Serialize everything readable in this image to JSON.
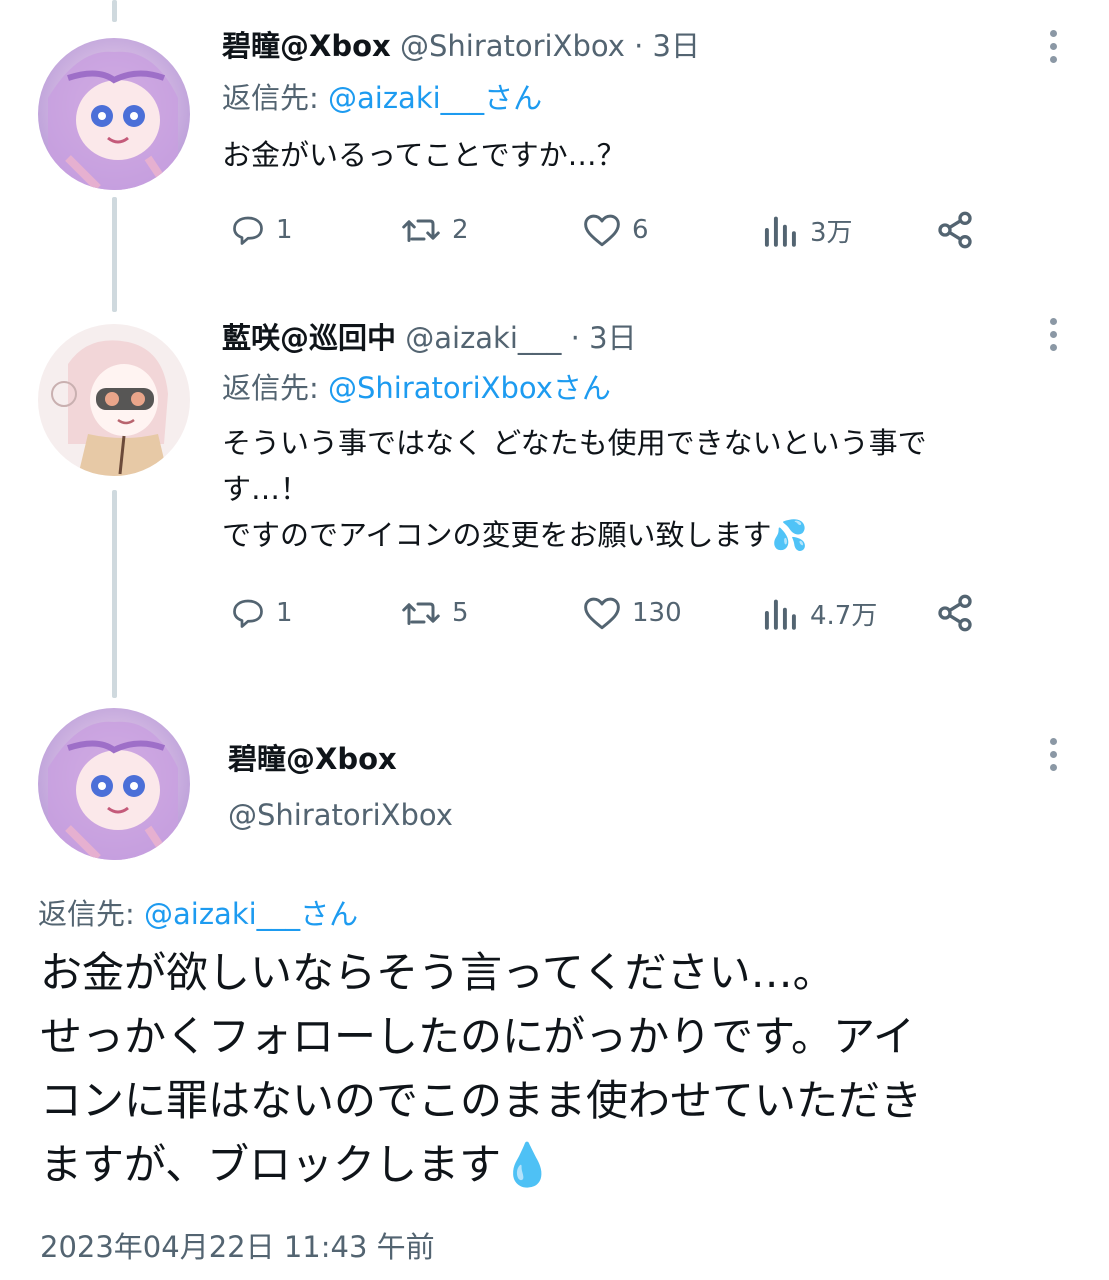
{
  "colors": {
    "accent": "#1d9bf0",
    "secondary": "#536471",
    "thread_line": "#cfd9de"
  },
  "tweets": [
    {
      "display_name": "碧瞳@Xbox",
      "handle": "@ShiratoriXbox",
      "separator": "·",
      "time": "3日",
      "reply_prefix": "返信先: ",
      "reply_mention": "@aizaki___さん",
      "text": "お金がいるってことですか…？",
      "replies": "1",
      "retweets": "2",
      "likes": "6",
      "views": "3万"
    },
    {
      "display_name": "藍咲@巡回中",
      "handle": "@aizaki___",
      "separator": "·",
      "time": "3日",
      "reply_prefix": "返信先: ",
      "reply_mention": "@ShiratoriXboxさん",
      "text": "そういう事ではなく どなたも使用できないという事で\nす…！\nですのでアイコンの変更をお願い致します💦",
      "replies": "1",
      "retweets": "5",
      "likes": "130",
      "views": "4.7万"
    }
  ],
  "main_tweet": {
    "display_name": "碧瞳@Xbox",
    "handle": "@ShiratoriXbox",
    "reply_prefix": "返信先: ",
    "reply_mention": "@aizaki___さん",
    "text": "お金が欲しいならそう言ってください…。\nせっかくフォローしたのにがっかりです。アイ\nコンに罪はないのでこのまま使わせていただき\nますが、ブロックします💧",
    "timestamp": "2023年04月22日 11:43 午前"
  },
  "icons": [
    "reply-icon",
    "retweet-icon",
    "like-icon",
    "views-icon",
    "share-icon",
    "more-icon"
  ]
}
